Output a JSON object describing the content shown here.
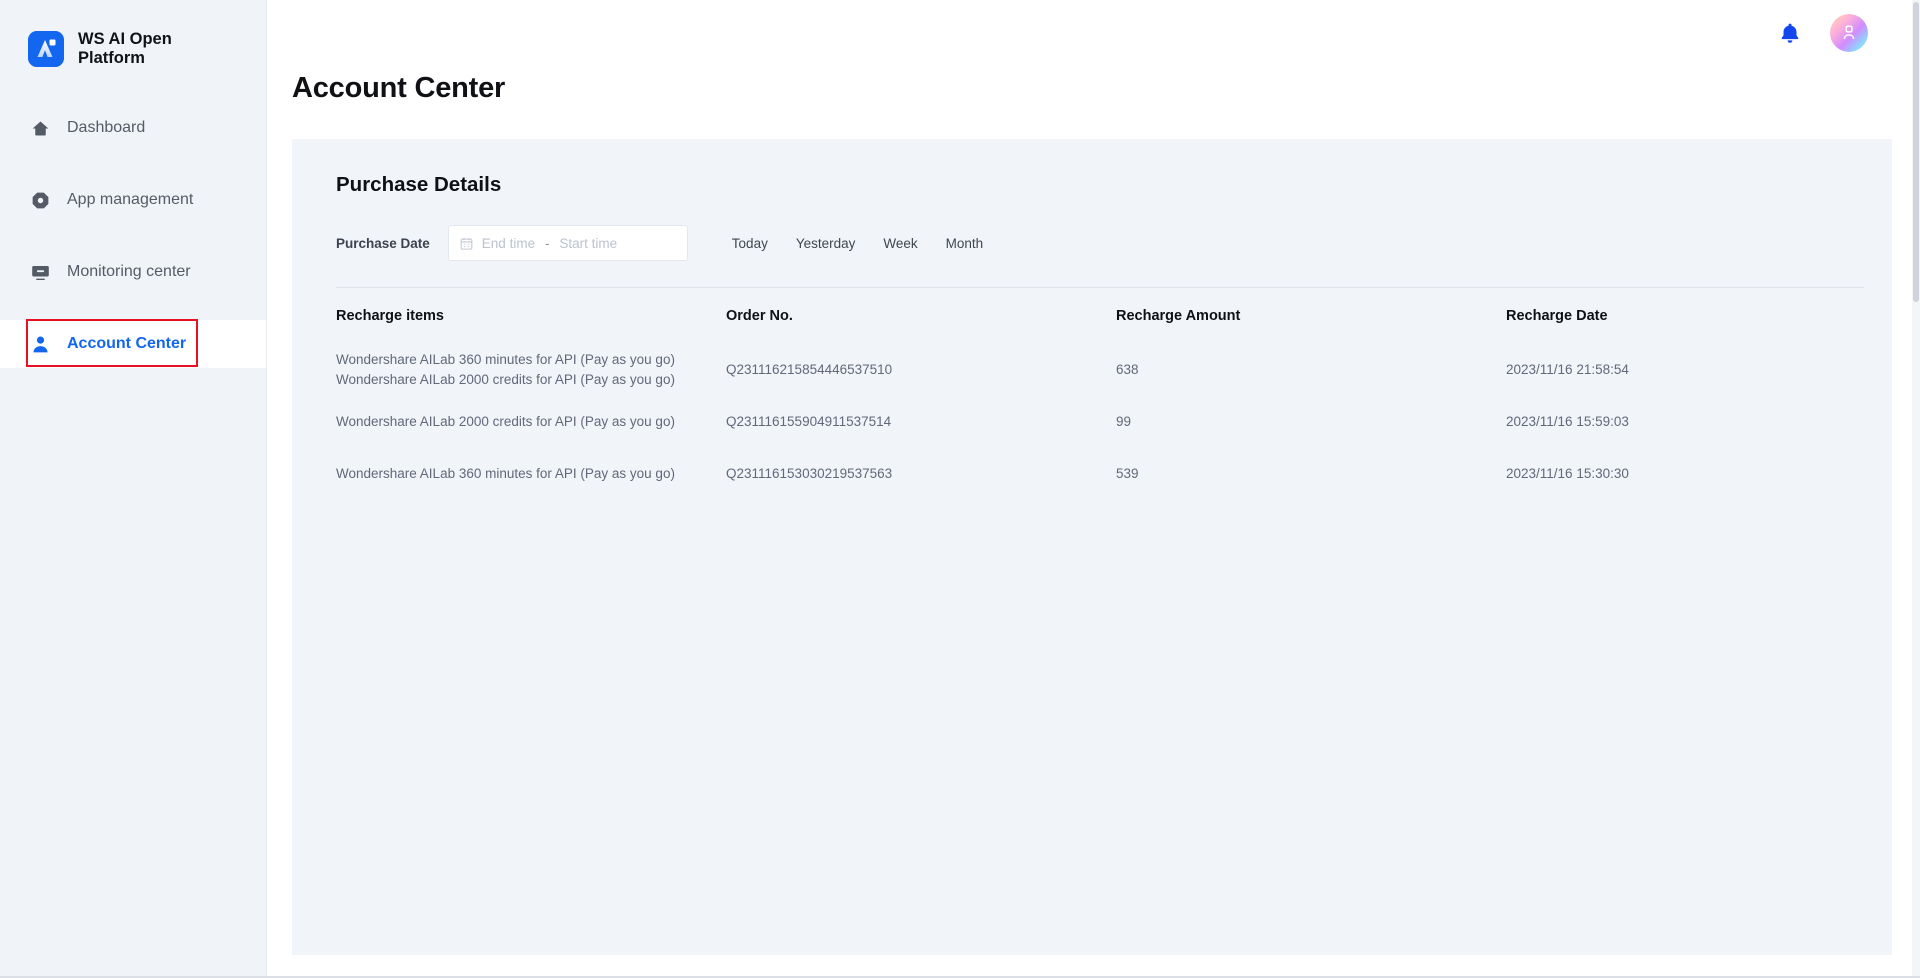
{
  "brand": {
    "name": "WS AI Open Platform",
    "logo_icon": "ws-ai-logo-icon",
    "logo_color": "#1366f0"
  },
  "sidebar": {
    "items": [
      {
        "label": "Dashboard",
        "icon": "home-icon",
        "active": false
      },
      {
        "label": "App management",
        "icon": "octagon-gear-icon",
        "active": false
      },
      {
        "label": "Monitoring center",
        "icon": "monitor-icon",
        "active": false
      },
      {
        "label": "Account Center",
        "icon": "user-icon",
        "active": true
      }
    ],
    "active_color": "#1366f0",
    "annotation_color": "#e81123"
  },
  "topbar": {
    "notification_icon": "bell-icon",
    "avatar_icon": "avatar-user-icon"
  },
  "page": {
    "title": "Account Center"
  },
  "card": {
    "title": "Purchase Details"
  },
  "filters": {
    "date_label": "Purchase Date",
    "calendar_icon": "calendar-icon",
    "end_time_placeholder": "End time",
    "separator": "-",
    "start_time_placeholder": "Start time",
    "end_time_value": "",
    "start_time_value": "",
    "quick_ranges": [
      "Today",
      "Yesterday",
      "Week",
      "Month"
    ]
  },
  "table": {
    "columns": [
      "Recharge items",
      "Order No.",
      "Recharge Amount",
      "Recharge Date"
    ],
    "rows": [
      {
        "items": "Wondershare AILab 360 minutes for API (Pay as you go)\nWondershare AILab 2000 credits for API (Pay as you go)",
        "order_no": "Q231116215854446537510",
        "amount": "638",
        "date": "2023/11/16 21:58:54"
      },
      {
        "items": "Wondershare AILab 2000 credits for API (Pay as you go)",
        "order_no": "Q231116155904911537514",
        "amount": "99",
        "date": "2023/11/16 15:59:03"
      },
      {
        "items": "Wondershare AILab 360 minutes for API (Pay as you go)",
        "order_no": "Q231116153030219537563",
        "amount": "539",
        "date": "2023/11/16 15:30:30"
      }
    ]
  }
}
